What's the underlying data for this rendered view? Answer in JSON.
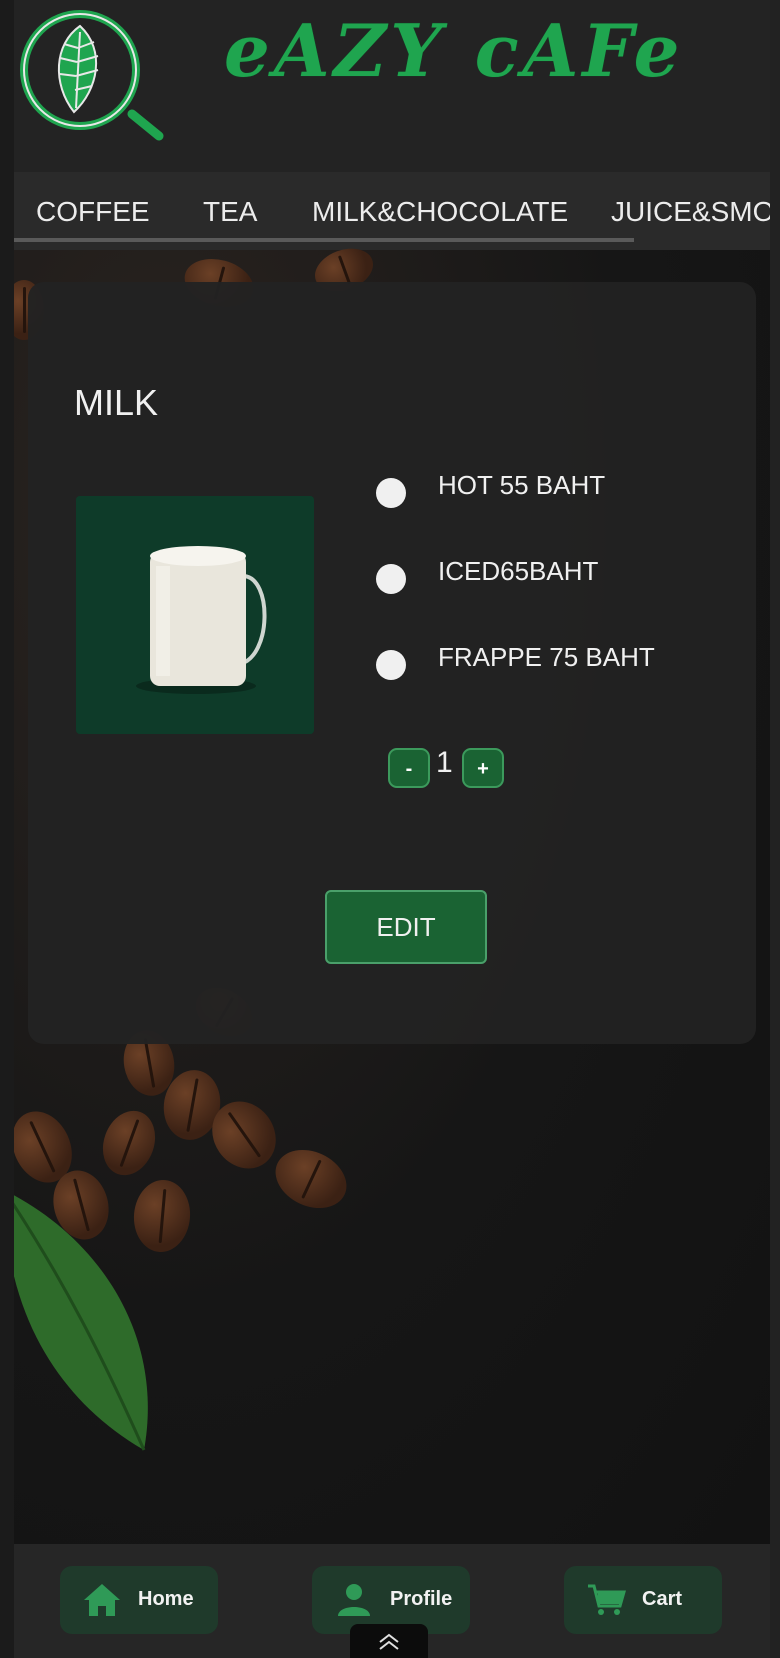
{
  "header": {
    "brand": "eAZY cAFe"
  },
  "tabs": [
    {
      "label": "COFFEE"
    },
    {
      "label": "TEA"
    },
    {
      "label": "MILK&CHOCOLATE"
    },
    {
      "label": "JUICE&SMOOTHIE"
    }
  ],
  "product": {
    "name": "MILK",
    "options": [
      {
        "label": "HOT 55 BAHT"
      },
      {
        "label": "ICED65BAHT"
      },
      {
        "label": "FRAPPE 75 BAHT"
      }
    ],
    "quantity": "1",
    "decrement_label": "-",
    "increment_label": "+",
    "edit_label": "EDIT"
  },
  "bottom_nav": [
    {
      "label": "Home",
      "icon": "home-icon"
    },
    {
      "label": "Profile",
      "icon": "profile-icon"
    },
    {
      "label": "Cart",
      "icon": "cart-icon"
    }
  ],
  "colors": {
    "brand": "#1fa54f",
    "button": "#1a6333",
    "nav_button": "#1f3a2b"
  }
}
